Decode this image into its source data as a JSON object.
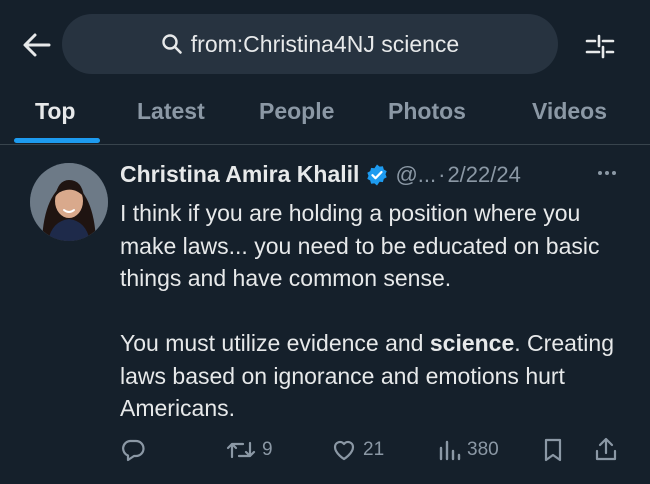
{
  "search": {
    "query": "from:Christina4NJ science"
  },
  "tabs": [
    {
      "label": "Top",
      "active": true
    },
    {
      "label": "Latest",
      "active": false
    },
    {
      "label": "People",
      "active": false
    },
    {
      "label": "Photos",
      "active": false
    },
    {
      "label": "Videos",
      "active": false
    }
  ],
  "tweet": {
    "name": "Christina Amira Khalil",
    "verified": true,
    "handle": "@...",
    "separator": "·",
    "date": "2/22/24",
    "paragraph1": "I think if you are holding a position where you make laws... you need to be educated on basic things and have common sense.",
    "paragraph2_before": "You must utilize evidence and ",
    "paragraph2_highlight": "science",
    "paragraph2_after": ". Creating laws based on ignorance and emotions hurt Americans.",
    "stats": {
      "replies": "",
      "retweets": "9",
      "likes": "21",
      "views": "380"
    }
  },
  "colors": {
    "background": "#15202b",
    "accent": "#1d9bf0",
    "text_primary": "#e7e9ea",
    "text_secondary": "#8b98a5",
    "search_bg": "#273340"
  },
  "icons": [
    "back-arrow-icon",
    "search-icon",
    "filter-sliders-icon",
    "verified-badge-icon",
    "more-icon",
    "reply-icon",
    "retweet-icon",
    "like-icon",
    "views-icon",
    "bookmark-icon",
    "share-icon"
  ]
}
